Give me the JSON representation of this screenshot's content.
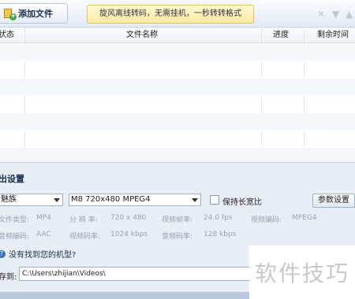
{
  "toolbar": {
    "add_file_label": "添加文件",
    "promo_text": "旋风离线转码，无需挂机，一秒转转格式",
    "icons": [
      "close-icon",
      "move-down-icon",
      "move-up-icon"
    ]
  },
  "file_table": {
    "headers": {
      "status": "状态",
      "file_name": "文件名称",
      "progress": "进度",
      "time_left": "剩余时间"
    },
    "rows": []
  },
  "settings": {
    "title": "出设置",
    "device_select": "魅族",
    "format_select": "M8 720x480 MPEG4",
    "keep_ratio_label": "保持长宽比",
    "params_button": "参数设置",
    "info": {
      "file_type_label": "文件类型:",
      "file_type_value": "MP4",
      "resolution_label": "分 辨 率:",
      "resolution_value": "720 x 480",
      "frame_rate_label": "视频帧率:",
      "frame_rate_value": "24.0 fps",
      "video_codec_label": "视频编码:",
      "video_codec_value": "MPEG4",
      "audio_codec_label": "音频编码:",
      "audio_codec_value": "AAC",
      "video_bitrate_label": "视频码率:",
      "video_bitrate_value": "1024 kbps",
      "audio_bitrate_label": "音频码率:",
      "audio_bitrate_value": "128 kbps"
    },
    "help_text": "没有找到您的机型?",
    "save_to_label": "存到:",
    "save_path": "C:\\Users\\zhijian\\Videos\\"
  },
  "watermark": "软件技巧"
}
